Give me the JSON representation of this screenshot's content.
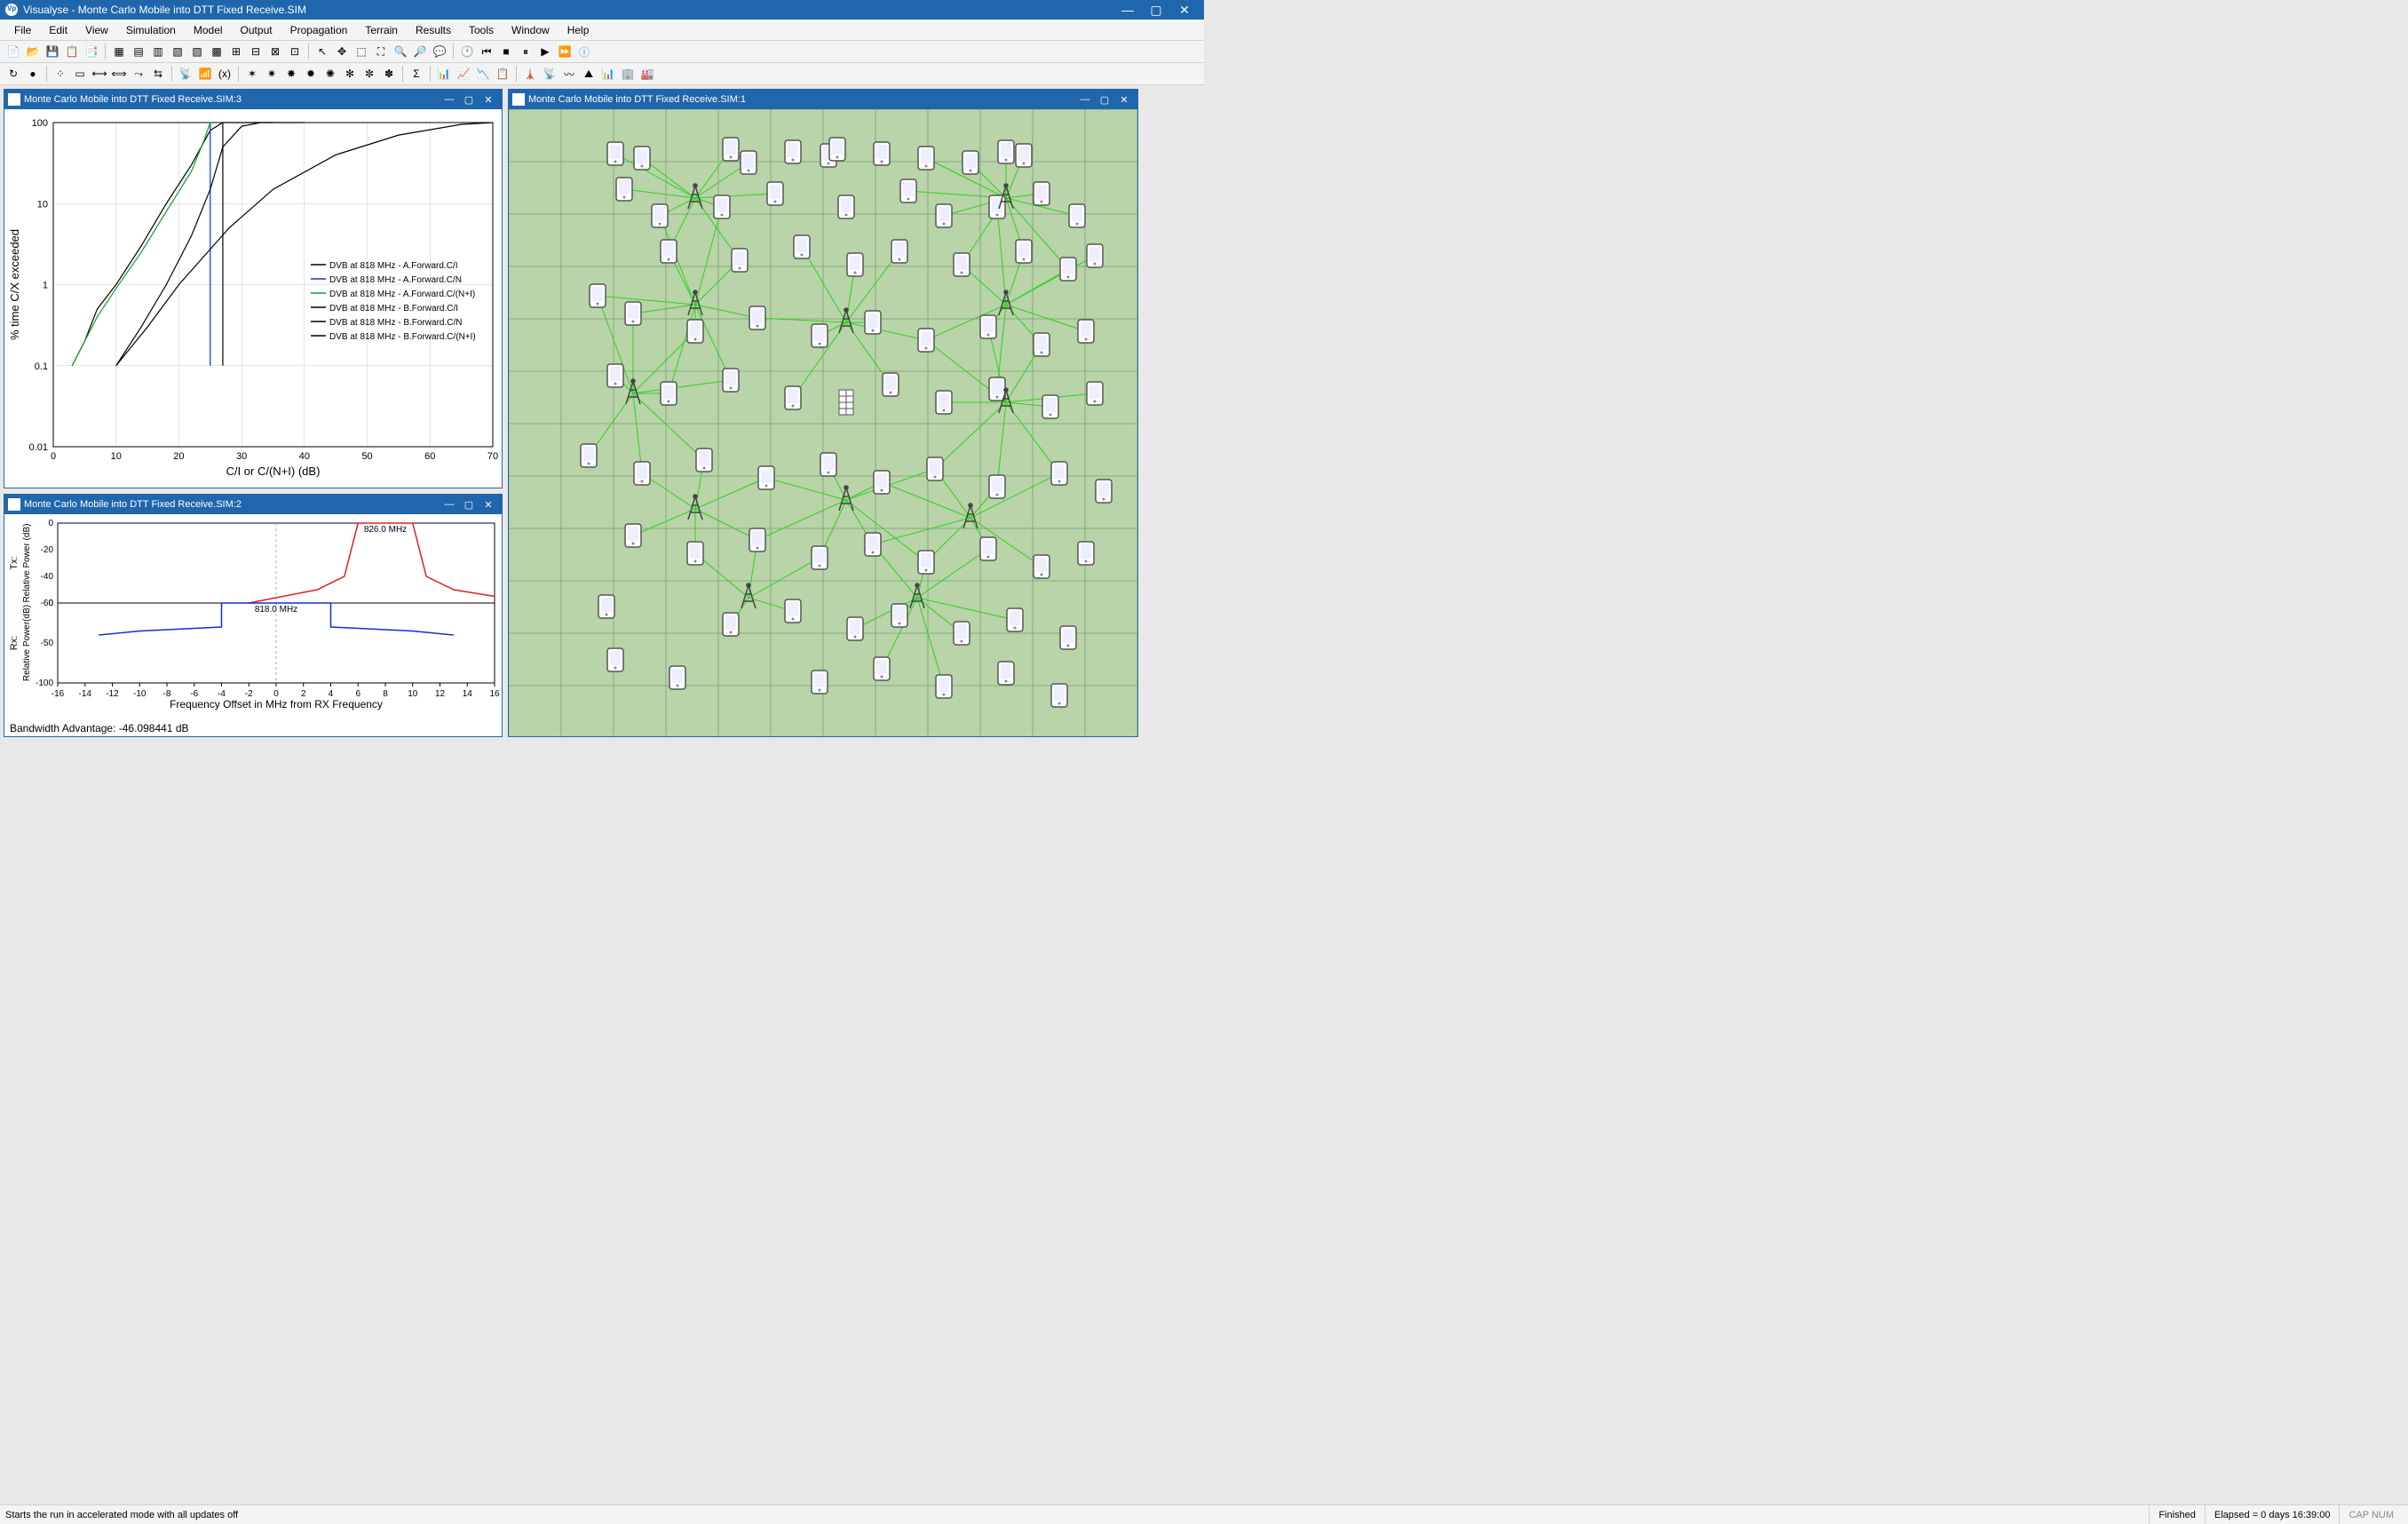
{
  "app_name": "Visualyse",
  "doc_name": "Monte Carlo Mobile into DTT Fixed Receive.SIM",
  "title_full": "Visualyse - Monte Carlo Mobile into DTT Fixed Receive.SIM",
  "menu": [
    "File",
    "Edit",
    "View",
    "Simulation",
    "Model",
    "Output",
    "Propagation",
    "Terrain",
    "Results",
    "Tools",
    "Window",
    "Help"
  ],
  "sub1": {
    "title": "Monte Carlo Mobile into DTT Fixed Receive.SIM:1"
  },
  "sub2": {
    "title": "Monte Carlo Mobile into DTT Fixed Receive.SIM:2",
    "bw_adv_label": "Bandwidth Advantage: -46.098441 dB"
  },
  "sub3": {
    "title": "Monte Carlo Mobile into DTT Fixed Receive.SIM:3"
  },
  "status": {
    "tip": "Starts the run in accelerated mode with all updates off",
    "state": "Finished",
    "elapsed": "Elapsed = 0 days 16:39:00",
    "caps": "CAP NUM"
  },
  "chart_data": [
    {
      "id": "cdf",
      "type": "line",
      "title": "",
      "xlabel": "C/I or C/(N+I) (dB)",
      "ylabel": "% time C/X exceeded",
      "xlim": [
        0,
        70
      ],
      "ylim": [
        0.01,
        100
      ],
      "yscale": "log",
      "xticks": [
        0,
        10,
        20,
        30,
        40,
        50,
        60,
        70
      ],
      "yticks": [
        0.01,
        0.1,
        1,
        10,
        100
      ],
      "legend": [
        {
          "name": "DVB at 818 MHz - A.Forward.C/I",
          "color": "#000000"
        },
        {
          "name": "DVB at 818 MHz - A.Forward.C/N",
          "color": "#1030d0"
        },
        {
          "name": "DVB at 818 MHz - A.Forward.C/(N+I)",
          "color": "#10a030"
        },
        {
          "name": "DVB at 818 MHz - B.Forward.C/I",
          "color": "#000000"
        },
        {
          "name": "DVB at 818 MHz - B.Forward.C/N",
          "color": "#000000"
        },
        {
          "name": "DVB at 818 MHz - B.Forward.C/(N+I)",
          "color": "#000000"
        }
      ],
      "series": [
        {
          "name": "A.Forward.C/I",
          "color": "#000000",
          "points": [
            [
              3,
              0.1
            ],
            [
              5,
              0.2
            ],
            [
              7,
              0.5
            ],
            [
              10,
              1
            ],
            [
              14,
              3
            ],
            [
              18,
              10
            ],
            [
              22,
              30
            ],
            [
              25,
              80
            ],
            [
              27,
              100
            ],
            [
              35,
              100
            ]
          ]
        },
        {
          "name": "A.Forward.C/N",
          "color": "#1030d0",
          "points": [
            [
              25,
              0.1
            ],
            [
              25,
              100
            ]
          ]
        },
        {
          "name": "A.Forward.C/(N+I)",
          "color": "#10a030",
          "points": [
            [
              3,
              0.1
            ],
            [
              5,
              0.2
            ],
            [
              7,
              0.4
            ],
            [
              10,
              0.9
            ],
            [
              14,
              2.5
            ],
            [
              18,
              8
            ],
            [
              22,
              25
            ],
            [
              24,
              60
            ],
            [
              25,
              100
            ]
          ]
        },
        {
          "name": "B.Forward.C/I",
          "color": "#000000",
          "points": [
            [
              10,
              0.1
            ],
            [
              15,
              0.3
            ],
            [
              20,
              1
            ],
            [
              28,
              5
            ],
            [
              35,
              15
            ],
            [
              45,
              40
            ],
            [
              55,
              70
            ],
            [
              65,
              95
            ],
            [
              70,
              100
            ]
          ]
        },
        {
          "name": "B.Forward.C/N",
          "color": "#000000",
          "points": [
            [
              27,
              0.1
            ],
            [
              27,
              100
            ]
          ]
        },
        {
          "name": "B.Forward.C/(N+I)",
          "color": "#000000",
          "points": [
            [
              10,
              0.1
            ],
            [
              14,
              0.3
            ],
            [
              18,
              1
            ],
            [
              22,
              4
            ],
            [
              25,
              15
            ],
            [
              27,
              50
            ],
            [
              30,
              90
            ],
            [
              33,
              100
            ],
            [
              40,
              100
            ]
          ]
        }
      ]
    },
    {
      "id": "spectrum",
      "type": "line",
      "xlabel": "Frequency Offset in MHz from RX Frequency",
      "ylabel_top": "Tx: Relative Power (dB)",
      "ylabel_bot": "Rx: Relative Power(dB)",
      "xlim": [
        -16,
        16
      ],
      "xticks": [
        -16,
        -14,
        -12,
        -10,
        -8,
        -6,
        -4,
        -2,
        0,
        2,
        4,
        6,
        8,
        10,
        12,
        14,
        16
      ],
      "tx": {
        "color": "#e02020",
        "annotation": "826.0 MHz",
        "yticks": [
          0,
          -20,
          -40,
          -60
        ],
        "points": [
          [
            -2,
            -60
          ],
          [
            3,
            -50
          ],
          [
            5,
            -40
          ],
          [
            6,
            0
          ],
          [
            10,
            0
          ],
          [
            11,
            -40
          ],
          [
            13,
            -50
          ],
          [
            16,
            -55
          ]
        ]
      },
      "rx": {
        "color": "#1030d0",
        "annotation": "818.0 MHz",
        "yticks": [
          0,
          -50,
          -100
        ],
        "points": [
          [
            -13,
            -40
          ],
          [
            -10,
            -35
          ],
          [
            -4,
            -30
          ],
          [
            -4,
            0
          ],
          [
            4,
            0
          ],
          [
            4,
            -30
          ],
          [
            10,
            -35
          ],
          [
            13,
            -40
          ]
        ]
      }
    }
  ],
  "map": {
    "towers": [
      [
        210,
        100
      ],
      [
        560,
        100
      ],
      [
        210,
        220
      ],
      [
        380,
        240
      ],
      [
        560,
        220
      ],
      [
        140,
        320
      ],
      [
        560,
        330
      ],
      [
        210,
        450
      ],
      [
        380,
        440
      ],
      [
        520,
        460
      ],
      [
        270,
        550
      ],
      [
        460,
        550
      ]
    ],
    "building": [
      [
        380,
        330
      ]
    ],
    "phones": [
      [
        120,
        50
      ],
      [
        150,
        55
      ],
      [
        250,
        45
      ],
      [
        270,
        60
      ],
      [
        320,
        48
      ],
      [
        360,
        52
      ],
      [
        370,
        45
      ],
      [
        420,
        50
      ],
      [
        470,
        55
      ],
      [
        520,
        60
      ],
      [
        560,
        48
      ],
      [
        580,
        52
      ],
      [
        130,
        90
      ],
      [
        170,
        120
      ],
      [
        240,
        110
      ],
      [
        300,
        95
      ],
      [
        380,
        110
      ],
      [
        450,
        92
      ],
      [
        490,
        120
      ],
      [
        550,
        110
      ],
      [
        600,
        95
      ],
      [
        640,
        120
      ],
      [
        180,
        160
      ],
      [
        260,
        170
      ],
      [
        330,
        155
      ],
      [
        390,
        175
      ],
      [
        440,
        160
      ],
      [
        510,
        175
      ],
      [
        580,
        160
      ],
      [
        630,
        180
      ],
      [
        660,
        165
      ],
      [
        100,
        210
      ],
      [
        140,
        230
      ],
      [
        210,
        250
      ],
      [
        280,
        235
      ],
      [
        350,
        255
      ],
      [
        410,
        240
      ],
      [
        470,
        260
      ],
      [
        540,
        245
      ],
      [
        600,
        265
      ],
      [
        650,
        250
      ],
      [
        120,
        300
      ],
      [
        180,
        320
      ],
      [
        250,
        305
      ],
      [
        320,
        325
      ],
      [
        430,
        310
      ],
      [
        490,
        330
      ],
      [
        550,
        315
      ],
      [
        610,
        335
      ],
      [
        660,
        320
      ],
      [
        90,
        390
      ],
      [
        150,
        410
      ],
      [
        220,
        395
      ],
      [
        290,
        415
      ],
      [
        360,
        400
      ],
      [
        420,
        420
      ],
      [
        480,
        405
      ],
      [
        550,
        425
      ],
      [
        620,
        410
      ],
      [
        670,
        430
      ],
      [
        140,
        480
      ],
      [
        210,
        500
      ],
      [
        280,
        485
      ],
      [
        350,
        505
      ],
      [
        410,
        490
      ],
      [
        470,
        510
      ],
      [
        540,
        495
      ],
      [
        600,
        515
      ],
      [
        650,
        500
      ],
      [
        110,
        560
      ],
      [
        250,
        580
      ],
      [
        320,
        565
      ],
      [
        390,
        585
      ],
      [
        440,
        570
      ],
      [
        510,
        590
      ],
      [
        570,
        575
      ],
      [
        630,
        595
      ],
      [
        120,
        620
      ],
      [
        190,
        640
      ],
      [
        350,
        645
      ],
      [
        420,
        630
      ],
      [
        490,
        650
      ],
      [
        560,
        635
      ],
      [
        620,
        660
      ]
    ]
  }
}
